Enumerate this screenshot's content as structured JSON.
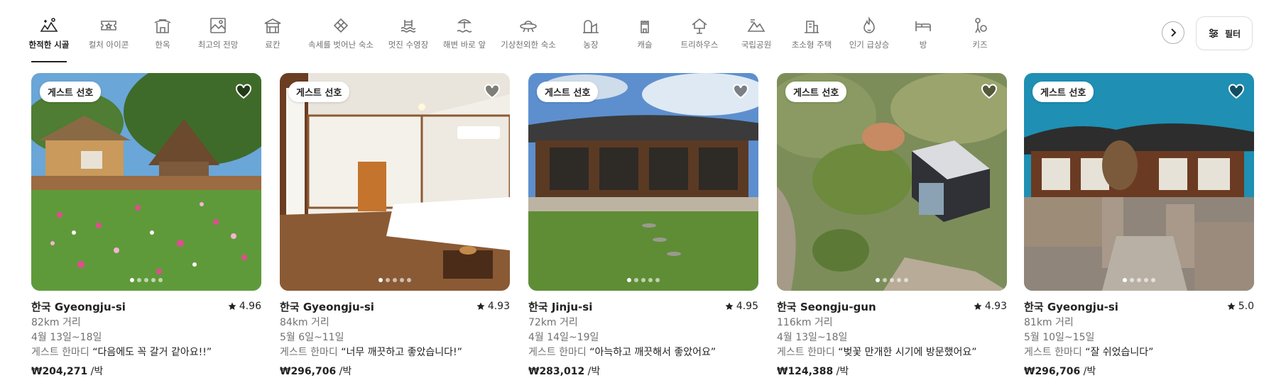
{
  "categories": [
    {
      "label": "한적한 시골",
      "icon": "countryside-icon",
      "active": true
    },
    {
      "label": "컬처 아이콘",
      "icon": "culture-ticket-icon",
      "active": false
    },
    {
      "label": "한옥",
      "icon": "hanok-icon",
      "active": false
    },
    {
      "label": "최고의 전망",
      "icon": "view-frame-icon",
      "active": false
    },
    {
      "label": "료칸",
      "icon": "ryokan-icon",
      "active": false
    },
    {
      "label": "속세를 벗어난 숙소",
      "icon": "offgrid-icon",
      "active": false
    },
    {
      "label": "멋진 수영장",
      "icon": "pool-icon",
      "active": false
    },
    {
      "label": "해변 바로 앞",
      "icon": "beachfront-icon",
      "active": false
    },
    {
      "label": "기상천외한 숙소",
      "icon": "ufo-icon",
      "active": false
    },
    {
      "label": "농장",
      "icon": "farm-icon",
      "active": false
    },
    {
      "label": "캐슬",
      "icon": "castle-icon",
      "active": false
    },
    {
      "label": "트리하우스",
      "icon": "treehouse-icon",
      "active": false
    },
    {
      "label": "국립공원",
      "icon": "national-park-icon",
      "active": false
    },
    {
      "label": "초소형 주택",
      "icon": "tiny-home-icon",
      "active": false
    },
    {
      "label": "인기 급상승",
      "icon": "trending-flame-icon",
      "active": false
    },
    {
      "label": "방",
      "icon": "room-bed-icon",
      "active": false
    },
    {
      "label": "키즈",
      "icon": "kids-icon",
      "active": false
    }
  ],
  "filter": {
    "label": "필터"
  },
  "listings": [
    {
      "badge": "게스트 선호",
      "title": "한국 Gyeongju-si",
      "rating": "4.96",
      "distance": "82km 거리",
      "dates": "4월 13일~18일",
      "review_prefix": "게스트 한마디",
      "review": "“다음에도 꼭 갈거 같아요!!”",
      "price": "₩204,271",
      "price_unit": " /박"
    },
    {
      "badge": "게스트 선호",
      "title": "한국 Gyeongju-si",
      "rating": "4.93",
      "distance": "84km 거리",
      "dates": "5월 6일~11일",
      "review_prefix": "게스트 한마디",
      "review": "“너무 깨끗하고 좋았습니다!”",
      "price": "₩296,706",
      "price_unit": " /박"
    },
    {
      "badge": "게스트 선호",
      "title": "한국 Jinju-si",
      "rating": "4.95",
      "distance": "72km 거리",
      "dates": "4월 14일~19일",
      "review_prefix": "게스트 한마디",
      "review": "“아늑하고 깨끗해서 좋았어요”",
      "price": "₩283,012",
      "price_unit": " /박"
    },
    {
      "badge": "게스트 선호",
      "title": "한국 Seongju-gun",
      "rating": "4.93",
      "distance": "116km 거리",
      "dates": "4월 13일~18일",
      "review_prefix": "게스트 한마디",
      "review": "“벚꽃 만개한 시기에 방문했어요”",
      "price": "₩124,388",
      "price_unit": " /박"
    },
    {
      "badge": "게스트 선호",
      "title": "한국 Gyeongju-si",
      "rating": "5.0",
      "distance": "81km 거리",
      "dates": "5월 10일~15일",
      "review_prefix": "게스트 한마디",
      "review": "“잘 쉬었습니다”",
      "price": "₩296,706",
      "price_unit": " /박"
    }
  ]
}
